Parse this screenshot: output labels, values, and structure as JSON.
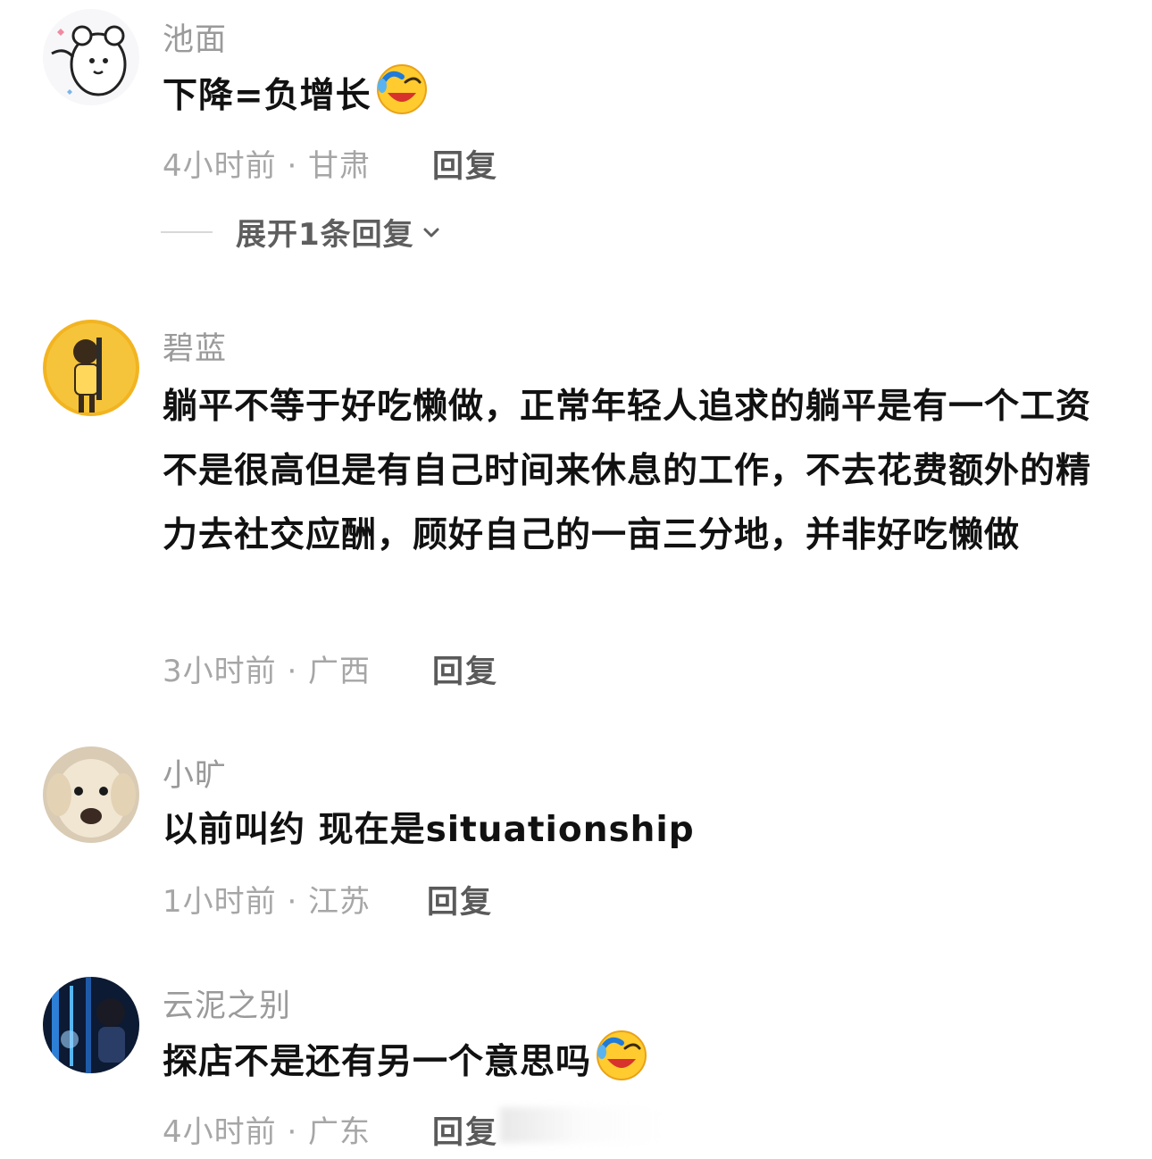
{
  "comments": [
    {
      "username": "池面",
      "text": "下降=负增长",
      "emoji": "laugh-cry-emoji",
      "time": "4小时前 · 甘肃",
      "reply_label": "回复",
      "expand_label": "展开1条回复"
    },
    {
      "username": "碧蓝",
      "text": "躺平不等于好吃懒做，正常年轻人追求的躺平是有一个工资不是很高但是有自己时间来休息的工作，不去花费额外的精力去社交应酬，顾好自己的一亩三分地，并非好吃懒做",
      "time": "3小时前 · 广西",
      "reply_label": "回复"
    },
    {
      "username": "小旷",
      "text": "以前叫约 现在是situationship",
      "time": "1小时前 · 江苏",
      "reply_label": "回复"
    },
    {
      "username": "云泥之别",
      "text": "探店不是还有另一个意思吗",
      "emoji": "laugh-cry-emoji",
      "time": "4小时前 · 广东",
      "reply_label": "回复"
    }
  ],
  "colors": {
    "background": "#ffffff",
    "username": "#9a9a9a",
    "content": "#111111",
    "meta": "#a6a6a6",
    "reply": "#5a5a5a"
  }
}
